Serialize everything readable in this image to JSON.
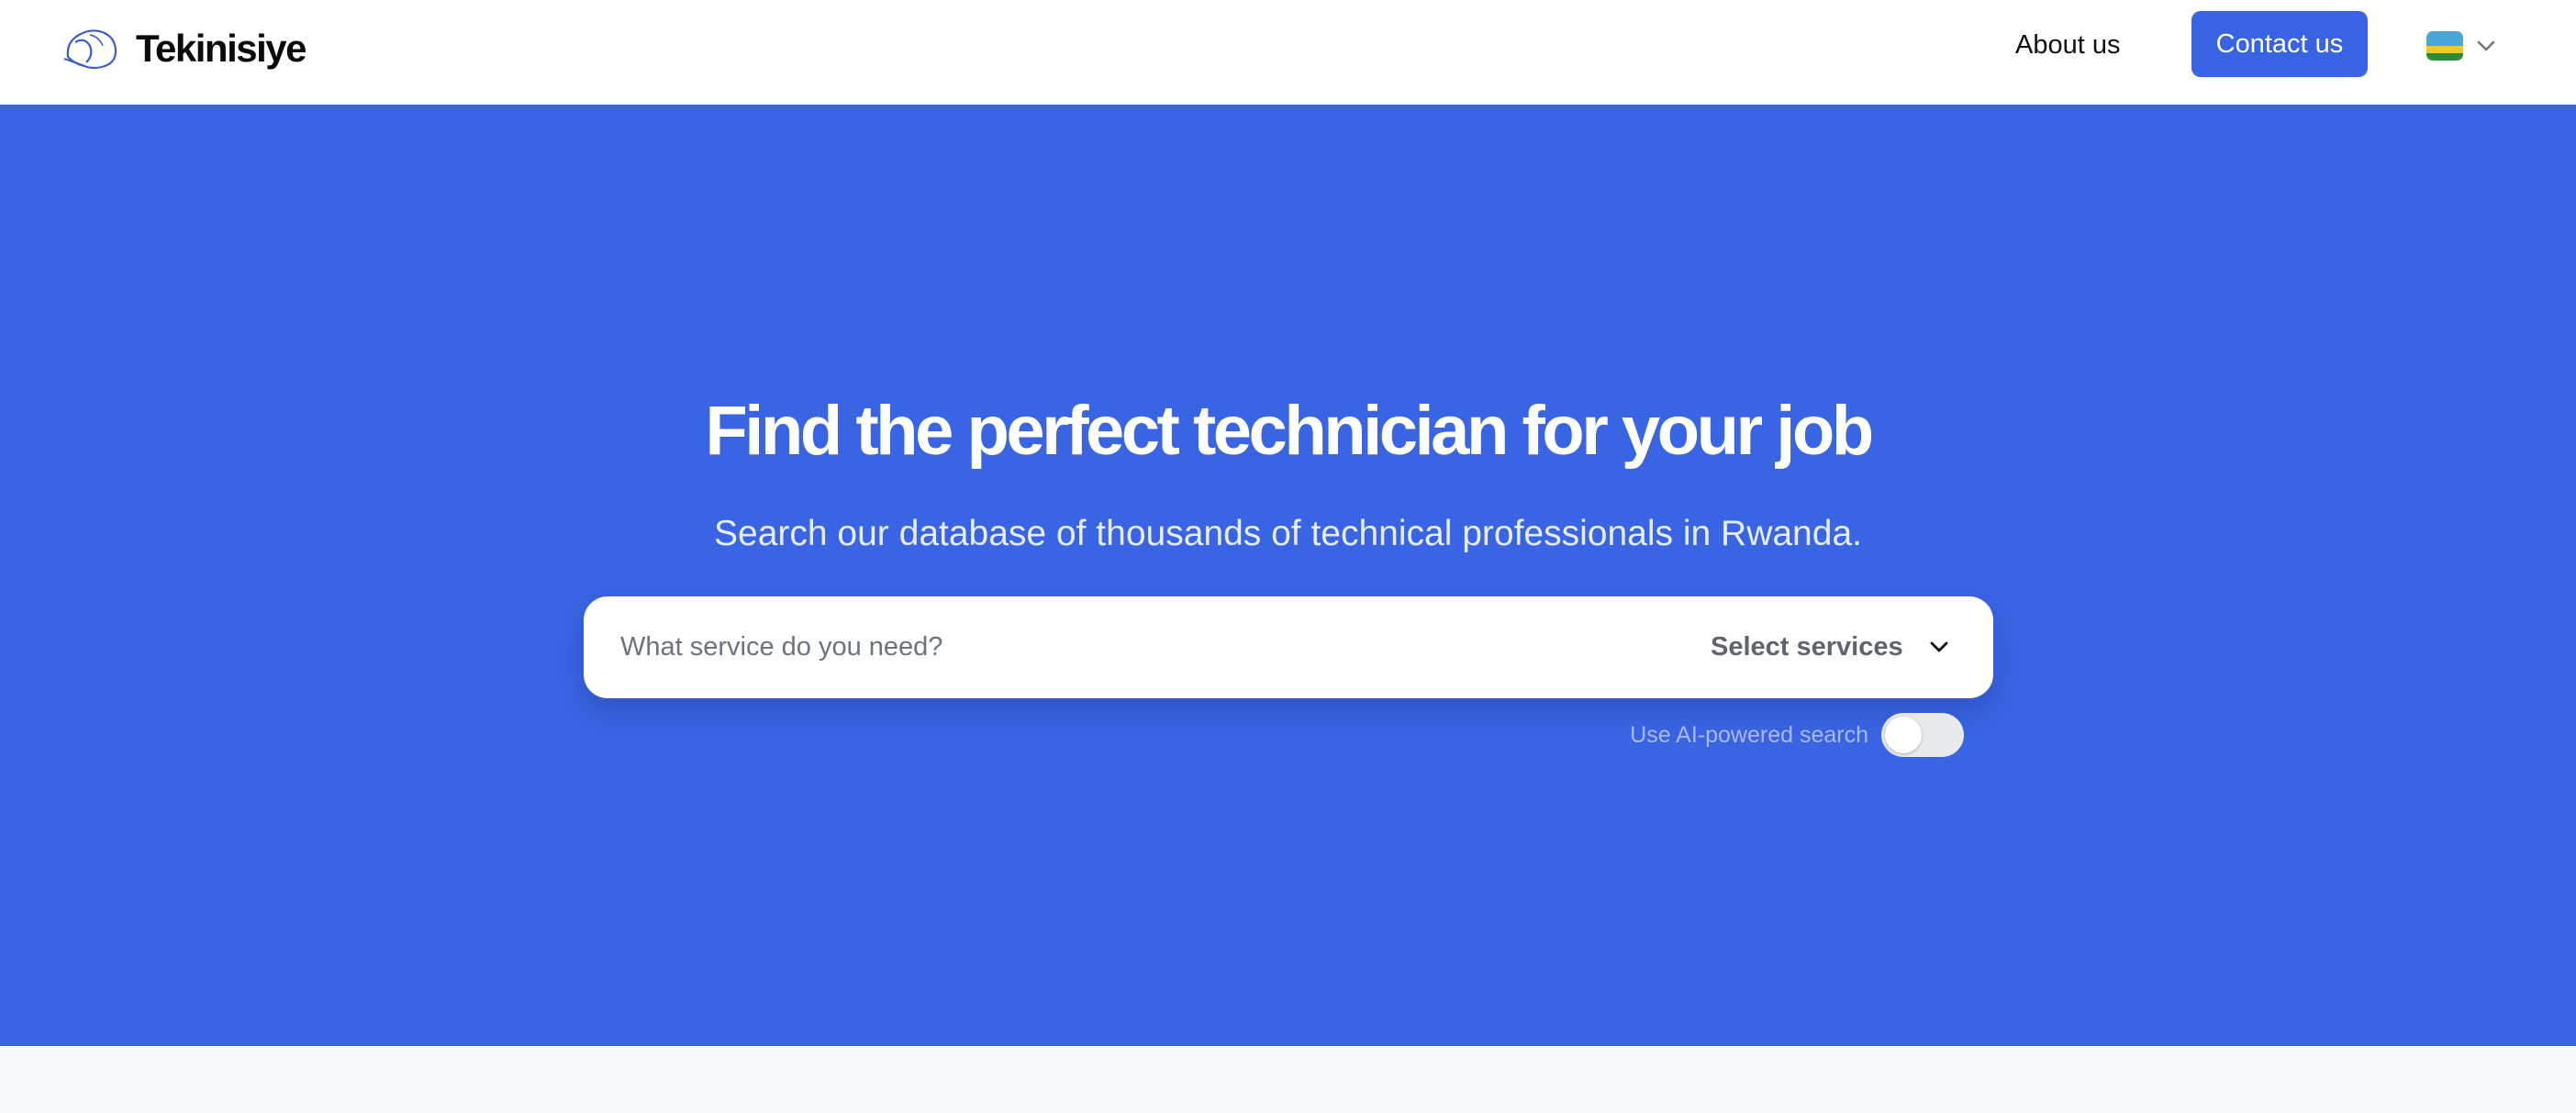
{
  "brand": {
    "name": "Tekinisiye",
    "logo_icon": "hard-hat-icon"
  },
  "nav": {
    "about_label": "About us",
    "contact_label": "Contact us",
    "language": {
      "flag_icon": "rwanda-flag-icon",
      "chevron_icon": "chevron-down-icon"
    }
  },
  "hero": {
    "title": "Find the perfect technician for your job",
    "subtitle": "Search our database of thousands of technical professionals in Rwanda.",
    "search": {
      "placeholder": "What service do you need?",
      "value": "",
      "service_select_label": "Select services",
      "chevron_icon": "chevron-down-icon"
    },
    "ai_search": {
      "label": "Use AI-powered search",
      "enabled": false
    }
  },
  "colors": {
    "primary": "#3964e3",
    "button": "#3864e4",
    "header_bg": "#ffffff",
    "page_bg": "#f8f9fb"
  }
}
